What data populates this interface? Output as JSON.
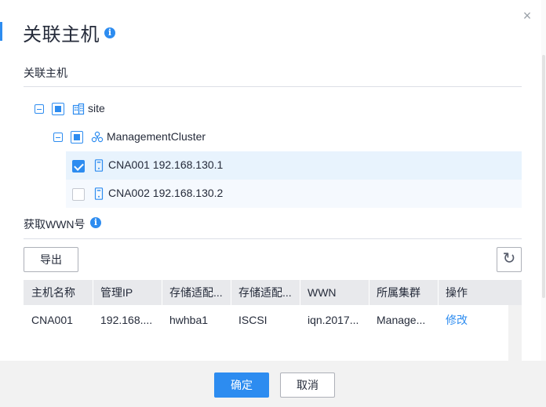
{
  "dialog": {
    "title": "关联主机",
    "title_info_glyph": "i",
    "close_glyph": "×"
  },
  "section_hosts": {
    "label": "关联主机"
  },
  "tree": {
    "root": {
      "label": "site",
      "icon": "building-icon",
      "state": "partial"
    },
    "cluster": {
      "label": "ManagementCluster",
      "icon": "cluster-icon",
      "state": "partial"
    },
    "hosts": [
      {
        "label": "CNA001 192.168.130.1",
        "icon": "server-icon",
        "checked": true
      },
      {
        "label": "CNA002 192.168.130.2",
        "icon": "server-icon",
        "checked": false
      }
    ]
  },
  "section_wwn": {
    "label": "获取WWN号",
    "info_glyph": "i"
  },
  "toolbar": {
    "export_label": "导出",
    "refresh_glyph": "↻"
  },
  "table": {
    "columns": [
      "主机名称",
      "管理IP",
      "存储适配...",
      "存储适配...",
      "WWN",
      "所属集群",
      "操作"
    ],
    "rows": [
      [
        "CNA001",
        "192.168....",
        "hwhba1",
        "ISCSI",
        "iqn.2017...",
        "Manage...",
        "修改"
      ]
    ]
  },
  "footer": {
    "confirm_label": "确定",
    "cancel_label": "取消"
  },
  "colors": {
    "accent": "#2d8cf0",
    "header_bg": "#e8e9ec",
    "selected_row_bg": "#e8f3fd"
  }
}
